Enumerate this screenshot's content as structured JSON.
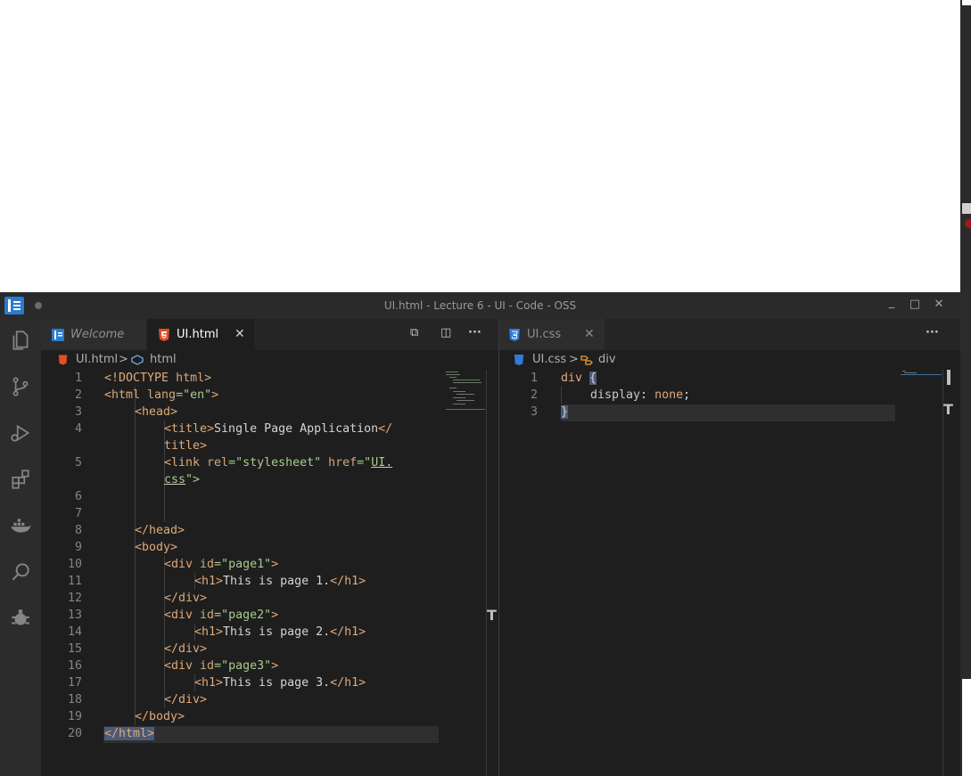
{
  "window": {
    "title": "UI.html - Lecture 6 - UI - Code - OSS",
    "controls": {
      "minimize": "_",
      "maximize": "□",
      "close": "✕"
    }
  },
  "activity_bar": {
    "items": [
      {
        "name": "explorer",
        "icon": "files-icon"
      },
      {
        "name": "source-control",
        "icon": "git-branch-icon"
      },
      {
        "name": "run-debug",
        "icon": "run-debug-icon"
      },
      {
        "name": "extensions",
        "icon": "extensions-icon"
      },
      {
        "name": "docker",
        "icon": "docker-icon"
      },
      {
        "name": "search",
        "icon": "search-icon"
      },
      {
        "name": "other",
        "icon": "bug-icon"
      }
    ]
  },
  "left_group": {
    "tabs": [
      {
        "label": "Welcome",
        "icon": "welcome-icon",
        "active": false,
        "italic": true
      },
      {
        "label": "UI.html",
        "icon": "html5-icon",
        "active": true,
        "close": "✕"
      }
    ],
    "actions": {
      "preview": "⧉",
      "split": "◫",
      "more": "···"
    },
    "breadcrumb": {
      "file": "UI.html",
      "separator": ">",
      "symbol": "html"
    },
    "line_numbers": [
      "1",
      "2",
      "3",
      "4",
      "",
      "5",
      "",
      "6",
      "7",
      "8",
      "9",
      "10",
      "11",
      "12",
      "13",
      "14",
      "15",
      "16",
      "17",
      "18",
      "19",
      "20"
    ],
    "code": {
      "l1": {
        "a": "<!DOCTYPE",
        "b": " html>"
      },
      "l2": {
        "a": "<html",
        "b": " lang",
        "c": "=\"en\"",
        "d": ">"
      },
      "l3": "<head>",
      "l4a": {
        "a": "<title>",
        "b": "Single Page Application",
        "c": "</"
      },
      "l4b": "title>",
      "l5a": {
        "a": "<link",
        "b": " rel",
        "c": "=\"stylesheet\"",
        "d": " href",
        "e": "=\"",
        "f": "UI."
      },
      "l5b": {
        "a": "css",
        "b": "\">"
      },
      "l8": "</head>",
      "l9": "<body>",
      "l10": {
        "a": "<div",
        "b": " id",
        "c": "=\"page1\"",
        "d": ">"
      },
      "l11": {
        "a": "<h1>",
        "b": "This is page 1.",
        "c": "</h1>"
      },
      "l12": "</div>",
      "l13": {
        "a": "<div",
        "b": " id",
        "c": "=\"page2\"",
        "d": ">"
      },
      "l14": {
        "a": "<h1>",
        "b": "This is page 2.",
        "c": "</h1>"
      },
      "l15": "</div>",
      "l16": {
        "a": "<div",
        "b": " id",
        "c": "=\"page3\"",
        "d": ">"
      },
      "l17": {
        "a": "<h1>",
        "b": "This is page 3.",
        "c": "</h1>"
      },
      "l18": "</div>",
      "l19": "</body>",
      "l20": {
        "a": "</html",
        "b": ">"
      }
    }
  },
  "right_group": {
    "tabs": [
      {
        "label": "UI.css",
        "icon": "css3-icon",
        "active": false,
        "close": "✕"
      }
    ],
    "actions": {
      "more": "···"
    },
    "breadcrumb": {
      "file": "UI.css",
      "separator": ">",
      "symbol": "div"
    },
    "line_numbers": [
      "1",
      "2",
      "3"
    ],
    "code": {
      "l1": {
        "a": "div",
        "b": " ",
        "c": "{"
      },
      "l2": {
        "a": "display",
        "b": ": ",
        "c": "none",
        "d": ";"
      },
      "l3": "}"
    }
  },
  "colors": {
    "editor_bg": "#1e1e1e",
    "tag": "#e0a978",
    "string": "#a8cc8c",
    "accent": "#2a7bd0"
  }
}
